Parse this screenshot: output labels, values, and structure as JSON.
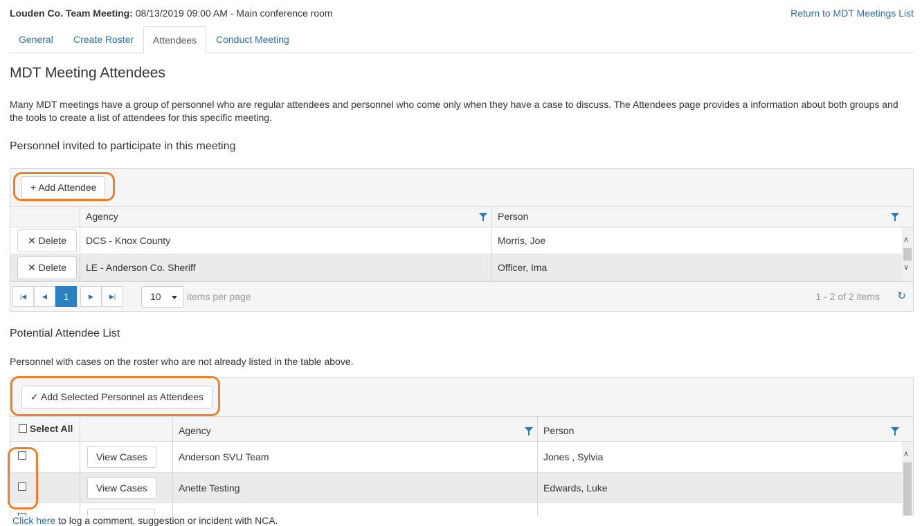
{
  "header": {
    "meeting_name": "Louden Co. Team Meeting:",
    "meeting_details": " 08/13/2019 09:00 AM - Main conference room",
    "return_link": "Return to MDT Meetings List"
  },
  "tabs": [
    {
      "label": "General"
    },
    {
      "label": "Create Roster"
    },
    {
      "label": "Attendees"
    },
    {
      "label": "Conduct Meeting"
    }
  ],
  "page": {
    "title": "MDT Meeting Attendees",
    "intro": "Many MDT meetings have a group of personnel who are regular attendees and personnel who come only when they have a case to discuss. The Attendees page provides a information about both groups and the tools to create a list of attendees for this specific meeting."
  },
  "invited": {
    "title": "Personnel invited to participate in this meeting",
    "add_button": "Add Attendee",
    "columns": {
      "agency": "Agency",
      "person": "Person"
    },
    "delete_label": "Delete",
    "rows": [
      {
        "agency": "DCS - Knox County",
        "person": "Morris, Joe"
      },
      {
        "agency": "LE - Anderson Co. Sheriff",
        "person": "Officer, Ima"
      }
    ],
    "pager": {
      "current_page": "1",
      "page_size": "10",
      "items_per_page": "items per page",
      "summary": "1 - 2 of 2 items"
    }
  },
  "potential": {
    "title": "Potential Attendee List",
    "subtitle": "Personnel with cases on the roster who are not already listed in the table above.",
    "add_button": "Add Selected Personnel as Attendees",
    "select_all": "Select All",
    "columns": {
      "agency": "Agency",
      "person": "Person"
    },
    "view_label": "View Cases",
    "rows": [
      {
        "agency": "Anderson SVU Team",
        "person": "Jones , Sylvia"
      },
      {
        "agency": "Anette Testing",
        "person": "Edwards, Luke"
      }
    ]
  },
  "footer": {
    "link": "Click here",
    "text": " to log a comment, suggestion or incident with NCA."
  },
  "colors": {
    "link": "#2a6fb0",
    "highlight": "#f07f2b",
    "page_active": "#2a80c2",
    "filter_icon": "#2a7ab8"
  }
}
